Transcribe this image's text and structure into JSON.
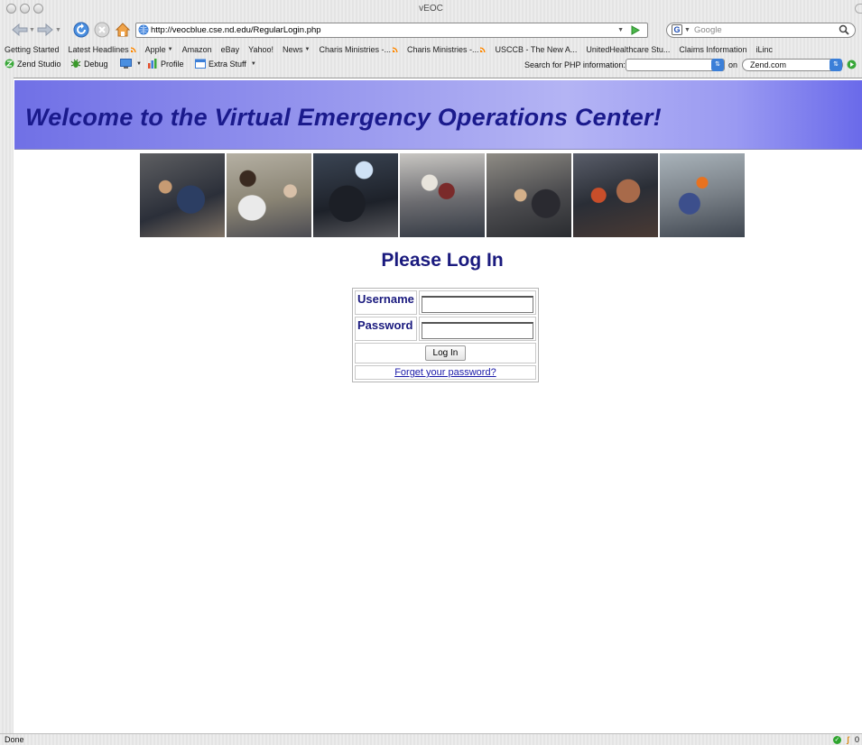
{
  "window": {
    "title": "vEOC"
  },
  "nav": {
    "url": "http://veocblue.cse.nd.edu/RegularLogin.php",
    "search_placeholder": "Google"
  },
  "bookmarks": [
    {
      "label": "Getting Started",
      "rss": false,
      "menu": false
    },
    {
      "label": "Latest Headlines",
      "rss": true,
      "menu": false
    },
    {
      "label": "Apple",
      "rss": false,
      "menu": true
    },
    {
      "label": "Amazon",
      "rss": false,
      "menu": false
    },
    {
      "label": "eBay",
      "rss": false,
      "menu": false
    },
    {
      "label": "Yahoo!",
      "rss": false,
      "menu": false
    },
    {
      "label": "News",
      "rss": false,
      "menu": true
    },
    {
      "label": "Charis Ministries -...",
      "rss": true,
      "menu": false
    },
    {
      "label": "Charis Ministries -...",
      "rss": true,
      "menu": false
    },
    {
      "label": "USCCB - The New A...",
      "rss": false,
      "menu": false
    },
    {
      "label": "UnitedHealthcare Stu...",
      "rss": false,
      "menu": false
    },
    {
      "label": "Claims Information",
      "rss": false,
      "menu": false
    },
    {
      "label": "iLinc",
      "rss": false,
      "menu": false
    }
  ],
  "zend": {
    "studio": "Zend Studio",
    "debug": "Debug",
    "profile": "Profile",
    "extra": "Extra Stuff",
    "search_label": "Search for PHP information:",
    "on_label": "on",
    "site": "Zend.com"
  },
  "page": {
    "banner_title": "Welcome to the Virtual Emergency Operations Center!",
    "login_title": "Please Log In",
    "username_label": "Username",
    "password_label": "Password",
    "login_button": "Log In",
    "forgot_link": "Forget your password?"
  },
  "status": {
    "text": "Done",
    "count": "0"
  },
  "colors": {
    "banner_text": "#1a1a8c",
    "heading": "#1a1a7e",
    "link": "#1a1aa8"
  }
}
